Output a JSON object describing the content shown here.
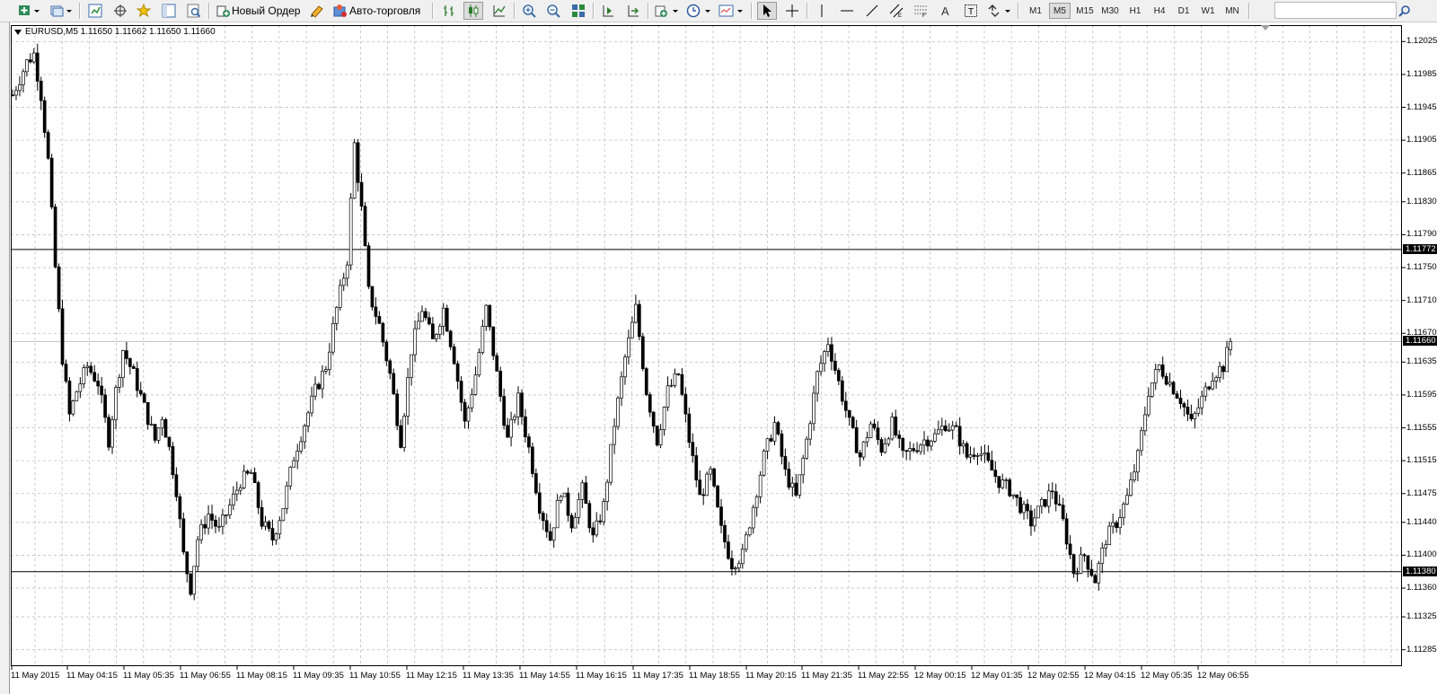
{
  "toolbar": {
    "new_order_label": "Новый Ордер",
    "auto_trading_label": "Авто-торговля",
    "timeframes": [
      "M1",
      "M5",
      "M15",
      "M30",
      "H1",
      "H4",
      "D1",
      "W1",
      "MN"
    ],
    "active_timeframe": "M5",
    "search_placeholder": ""
  },
  "chart": {
    "symbol_header": "EURUSD,M5  1.11650 1.11662 1.11650 1.11660",
    "price_axis": [
      "1.12025",
      "1.11985",
      "1.11945",
      "1.11905",
      "1.11865",
      "1.11830",
      "1.11790",
      "1.11750",
      "1.11710",
      "1.11670",
      "1.11635",
      "1.11595",
      "1.11555",
      "1.11515",
      "1.11475",
      "1.11440",
      "1.11400",
      "1.11360",
      "1.11325",
      "1.11285"
    ],
    "horizontal_lines": [
      {
        "price": 1.11772,
        "label": "1.11772"
      },
      {
        "price": 1.1138,
        "label": "1.11380"
      }
    ],
    "bid_line": {
      "price": 1.1166,
      "label": "1.11660"
    },
    "time_axis": [
      "11 May 2015",
      "11 May 04:15",
      "11 May 05:35",
      "11 May 06:55",
      "11 May 08:15",
      "11 May 09:35",
      "11 May 10:55",
      "11 May 12:15",
      "11 May 13:35",
      "11 May 14:55",
      "11 May 16:15",
      "11 May 17:35",
      "11 May 18:55",
      "11 May 20:15",
      "11 May 21:35",
      "11 May 22:55",
      "12 May 00:15",
      "12 May 01:35",
      "12 May 02:55",
      "12 May 04:15",
      "12 May 05:35",
      "12 May 06:55"
    ],
    "colors": {
      "background": "#ffffff",
      "grid": "#c0c0c0",
      "bar_up": "#ffffff",
      "bar_down": "#000000",
      "line": "#000000"
    }
  },
  "chart_data": {
    "type": "candlestick",
    "symbol": "EURUSD",
    "timeframe": "M5",
    "current": {
      "open": 1.1165,
      "high": 1.11662,
      "low": 1.1165,
      "close": 1.1166
    },
    "ylim": [
      1.11265,
      1.12045
    ],
    "close_path": [
      [
        0,
        1.1196
      ],
      [
        4,
        1.12
      ],
      [
        6,
        1.1201
      ],
      [
        8,
        1.1196
      ],
      [
        10,
        1.1188
      ],
      [
        12,
        1.1175
      ],
      [
        14,
        1.1164
      ],
      [
        16,
        1.1157
      ],
      [
        18,
        1.116
      ],
      [
        21,
        1.1163
      ],
      [
        24,
        1.1161
      ],
      [
        27,
        1.1154
      ],
      [
        29,
        1.116
      ],
      [
        31,
        1.1165
      ],
      [
        34,
        1.1162
      ],
      [
        37,
        1.1158
      ],
      [
        40,
        1.1154
      ],
      [
        42,
        1.1157
      ],
      [
        44,
        1.1153
      ],
      [
        46,
        1.1148
      ],
      [
        48,
        1.114
      ],
      [
        50,
        1.1136
      ],
      [
        52,
        1.1142
      ],
      [
        55,
        1.1145
      ],
      [
        58,
        1.1143
      ],
      [
        61,
        1.1146
      ],
      [
        64,
        1.1149
      ],
      [
        67,
        1.115
      ],
      [
        70,
        1.1144
      ],
      [
        73,
        1.1142
      ],
      [
        76,
        1.1146
      ],
      [
        79,
        1.1152
      ],
      [
        82,
        1.1156
      ],
      [
        85,
        1.116
      ],
      [
        88,
        1.1163
      ],
      [
        91,
        1.117
      ],
      [
        94,
        1.1176
      ],
      [
        96,
        1.119
      ],
      [
        98,
        1.1182
      ],
      [
        100,
        1.1172
      ],
      [
        103,
        1.1168
      ],
      [
        106,
        1.1162
      ],
      [
        109,
        1.1154
      ],
      [
        112,
        1.1165
      ],
      [
        115,
        1.117
      ],
      [
        118,
        1.1166
      ],
      [
        121,
        1.117
      ],
      [
        124,
        1.1164
      ],
      [
        127,
        1.1156
      ],
      [
        130,
        1.1162
      ],
      [
        133,
        1.117
      ],
      [
        136,
        1.1162
      ],
      [
        139,
        1.1154
      ],
      [
        142,
        1.1159
      ],
      [
        145,
        1.1153
      ],
      [
        148,
        1.1146
      ],
      [
        151,
        1.1142
      ],
      [
        154,
        1.1148
      ],
      [
        157,
        1.1144
      ],
      [
        160,
        1.1148
      ],
      [
        163,
        1.1142
      ],
      [
        166,
        1.1146
      ],
      [
        169,
        1.1156
      ],
      [
        172,
        1.1164
      ],
      [
        175,
        1.117
      ],
      [
        178,
        1.116
      ],
      [
        181,
        1.1154
      ],
      [
        184,
        1.116
      ],
      [
        187,
        1.1162
      ],
      [
        190,
        1.1154
      ],
      [
        193,
        1.1147
      ],
      [
        196,
        1.115
      ],
      [
        199,
        1.1143
      ],
      [
        202,
        1.1139
      ],
      [
        205,
        1.114
      ],
      [
        208,
        1.1146
      ],
      [
        211,
        1.1152
      ],
      [
        214,
        1.1156
      ],
      [
        217,
        1.115
      ],
      [
        220,
        1.1147
      ],
      [
        223,
        1.1154
      ],
      [
        226,
        1.1162
      ],
      [
        229,
        1.1166
      ],
      [
        232,
        1.1161
      ],
      [
        235,
        1.1156
      ],
      [
        238,
        1.1152
      ],
      [
        241,
        1.1156
      ],
      [
        244,
        1.1153
      ],
      [
        247,
        1.1156
      ],
      [
        250,
        1.1152
      ],
      [
        253,
        1.1153
      ],
      [
        256,
        1.1154
      ],
      [
        259,
        1.11545
      ],
      [
        262,
        1.1156
      ],
      [
        265,
        1.1155
      ],
      [
        268,
        1.1152
      ],
      [
        271,
        1.1153
      ],
      [
        274,
        1.1151
      ],
      [
        277,
        1.1149
      ],
      [
        280,
        1.1148
      ],
      [
        283,
        1.1146
      ],
      [
        286,
        1.1144
      ],
      [
        289,
        1.1146
      ],
      [
        292,
        1.1148
      ],
      [
        295,
        1.1144
      ],
      [
        298,
        1.1138
      ],
      [
        301,
        1.114
      ],
      [
        304,
        1.1137
      ],
      [
        307,
        1.1142
      ],
      [
        310,
        1.1144
      ],
      [
        313,
        1.1147
      ],
      [
        316,
        1.1152
      ],
      [
        319,
        1.116
      ],
      [
        322,
        1.1163
      ],
      [
        325,
        1.1161
      ],
      [
        328,
        1.1159
      ],
      [
        331,
        1.1156
      ],
      [
        334,
        1.1159
      ],
      [
        337,
        1.1162
      ],
      [
        340,
        1.1163
      ],
      [
        342,
        1.1166
      ]
    ],
    "bar_count": 343,
    "horizontal_lines": [
      1.11772,
      1.1138
    ]
  }
}
